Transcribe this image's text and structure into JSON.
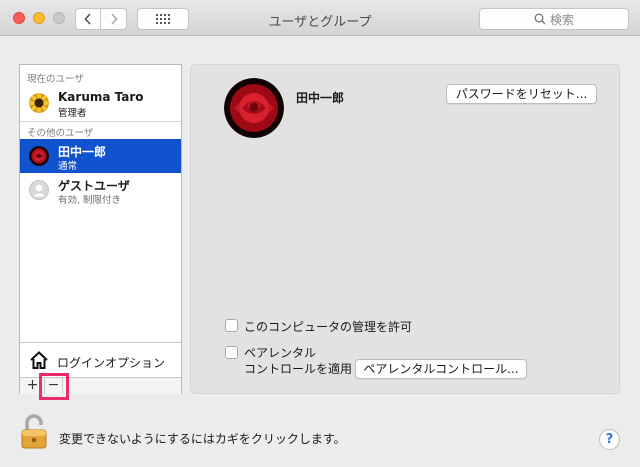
{
  "window": {
    "title": "ユーザとグループ"
  },
  "toolbar": {
    "search_placeholder": "検索",
    "back_icon": "chevron-left-icon",
    "forward_icon": "chevron-right-icon",
    "grid_icon": "grid-icon"
  },
  "sidebar": {
    "current_label": "現在のユーザ",
    "current_user": {
      "name": "Karuma Taro",
      "role": "管理者"
    },
    "other_label": "その他のユーザ",
    "other_users": [
      {
        "name": "田中一郎",
        "role": "通常",
        "selected": true
      },
      {
        "name": "ゲストユーザ",
        "role": "有効, 制限付き",
        "selected": false
      }
    ],
    "login_options": "ログインオプション",
    "add_symbol": "+",
    "remove_symbol": "−"
  },
  "panel": {
    "user_name": "田中一郎",
    "reset_password": "パスワードをリセット...",
    "allow_admin": "このコンピュータの管理を許可",
    "parental_line1": "ペアレンタル",
    "parental_line2": "コントロールを適用",
    "parental_button": "ペアレンタルコントロール..."
  },
  "footer": {
    "lock_text": "変更できないようにするにはカギをクリックします。",
    "help_symbol": "?"
  },
  "colors": {
    "selection": "#1153cf",
    "highlight": "#ee2a68",
    "close": "#fc5f57",
    "minimize": "#fdbc2e"
  }
}
